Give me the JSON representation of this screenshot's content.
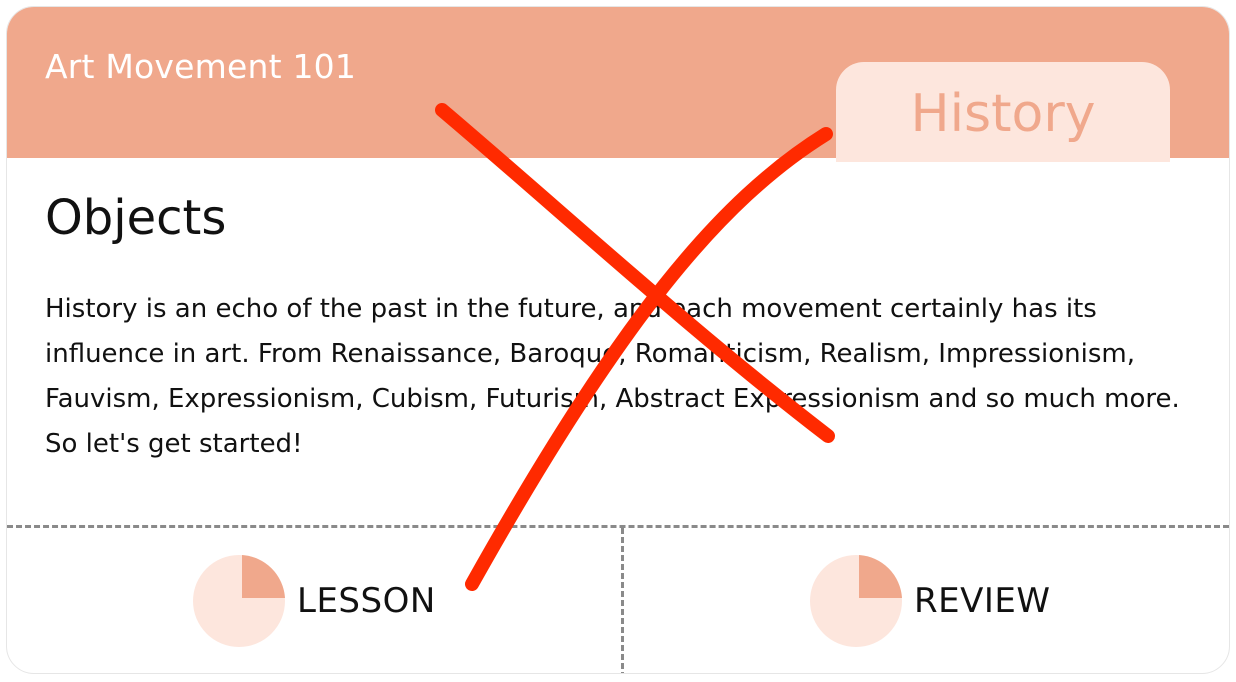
{
  "header": {
    "course_title": "Art Movement 101",
    "tab_label": "History"
  },
  "main": {
    "section_title": "Objects",
    "description": "History is an echo of the past in the future, and each movement certainly has its influence in art. From Renaissance, Baroque, Romanticism, Realism, Impressionism, Fauvism, Expressionism, Cubism, Futurism, Abstract Expressionism and so much more. So let's get started!"
  },
  "actions": {
    "lesson_label": "LESSON",
    "review_label": "REVIEW",
    "lesson_progress_icon": "pie-progress-icon",
    "review_progress_icon": "pie-progress-icon"
  },
  "colors": {
    "header_bg": "#f0a88c",
    "tab_bg": "#fde6dd",
    "pie_light": "#fde6dd",
    "pie_dark": "#f0a88c",
    "annotation_cross": "#ff2a00"
  }
}
